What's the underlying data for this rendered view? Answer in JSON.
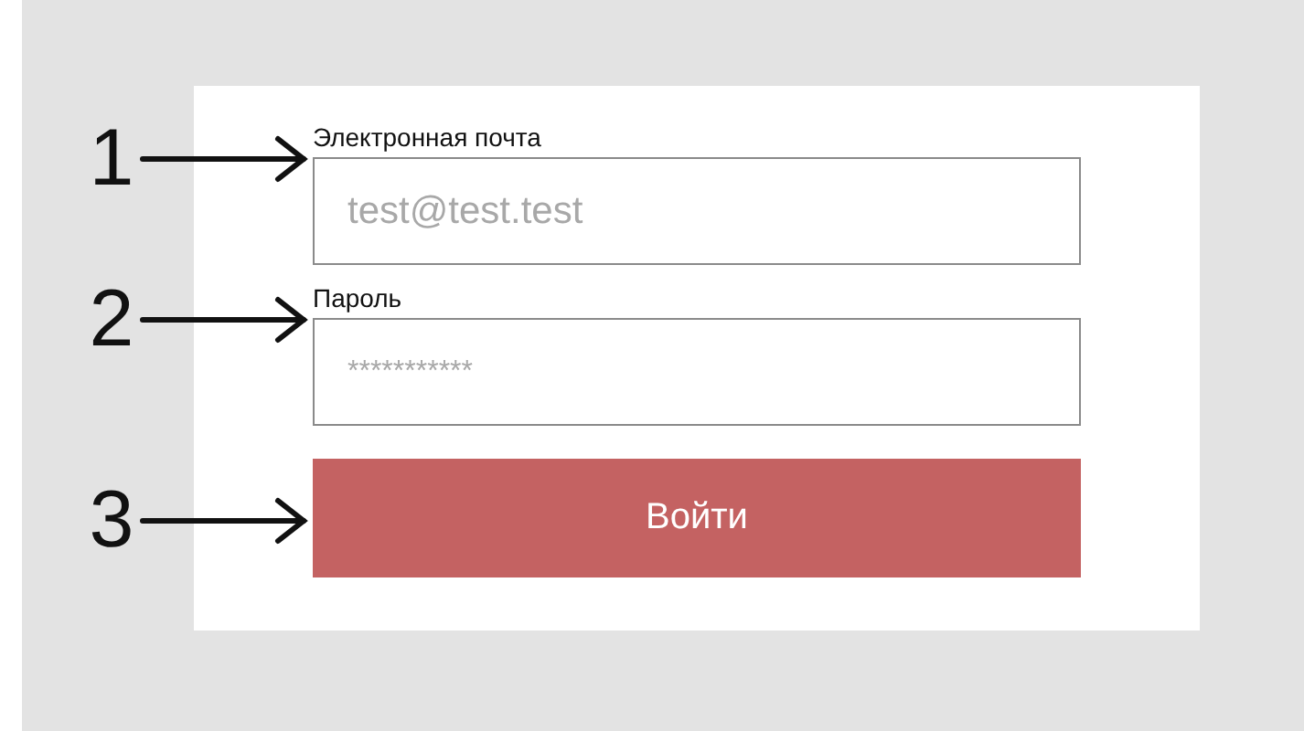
{
  "annotations": [
    {
      "label": "1"
    },
    {
      "label": "2"
    },
    {
      "label": "3"
    }
  ],
  "form": {
    "fields": [
      {
        "kind": "email",
        "label": "Электронная почта",
        "placeholder": "test@test.test"
      },
      {
        "kind": "password",
        "label": "Пароль",
        "placeholder": "***********"
      }
    ],
    "submit": "Войти"
  }
}
